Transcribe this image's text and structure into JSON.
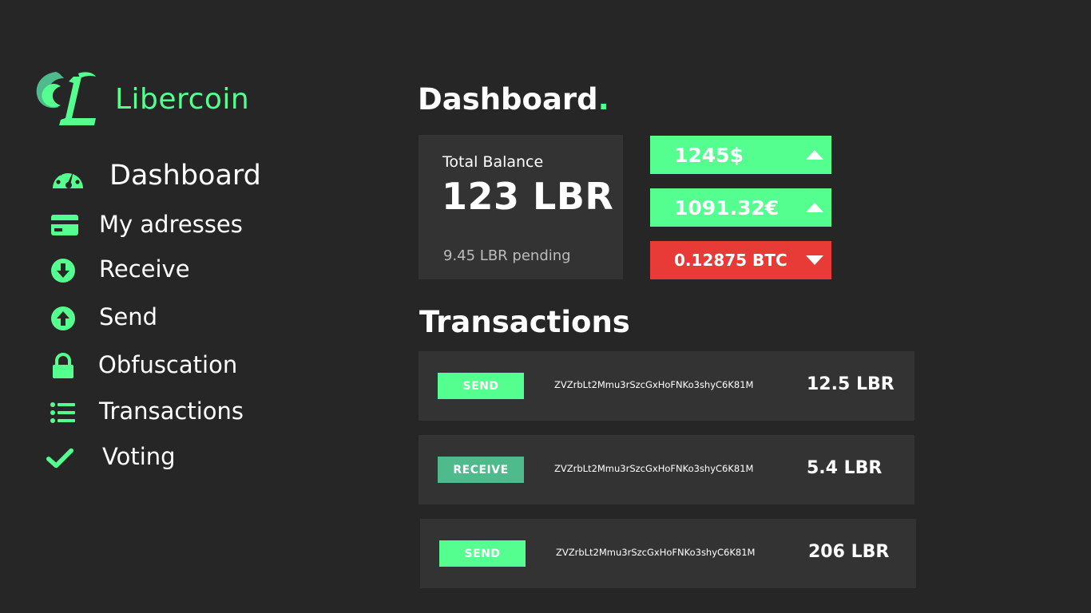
{
  "brand": {
    "name": "Libercoin",
    "accent_color": "#55ff8f",
    "logo_icon": "libercoin-logo-icon"
  },
  "sidebar": {
    "items": [
      {
        "label": "Dashboard",
        "icon": "speedometer-icon"
      },
      {
        "label": "My adresses",
        "icon": "card-icon"
      },
      {
        "label": "Receive",
        "icon": "arrow-down-circle-icon"
      },
      {
        "label": "Send",
        "icon": "arrow-up-circle-icon"
      },
      {
        "label": "Obfuscation",
        "icon": "lock-icon"
      },
      {
        "label": "Transactions",
        "icon": "list-icon"
      },
      {
        "label": "Voting",
        "icon": "check-icon"
      }
    ]
  },
  "dashboard": {
    "title": "Dashboard",
    "title_dot": ".",
    "balance": {
      "label": "Total Balance",
      "value": "123 LBR",
      "pending": "9.45 LBR pending"
    },
    "rates": [
      {
        "value": "1245$",
        "trend": "up",
        "color": "#55ff8f"
      },
      {
        "value": "1091.32€",
        "trend": "up",
        "color": "#55ff8f"
      },
      {
        "value": "0.12875 BTC",
        "trend": "down",
        "color": "#e83a36"
      }
    ]
  },
  "transactions": {
    "title": "Transactions",
    "rows": [
      {
        "type": "SEND",
        "address": "ZVZrbLt2Mmu3rSzcGxHoFNKo3shyC6K81M",
        "amount": "12.5 LBR"
      },
      {
        "type": "RECEIVE",
        "address": "ZVZrbLt2Mmu3rSzcGxHoFNKo3shyC6K81M",
        "amount": "5.4 LBR"
      },
      {
        "type": "SEND",
        "address": "ZVZrbLt2Mmu3rSzcGxHoFNKo3shyC6K81M",
        "amount": "206 LBR"
      }
    ]
  }
}
